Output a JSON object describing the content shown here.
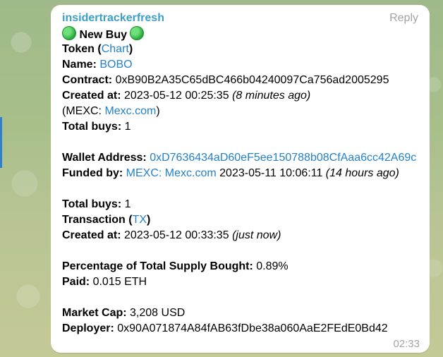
{
  "message": {
    "sender": "insidertrackerfresh",
    "reply_label": "Reply",
    "headline": "New Buy",
    "token_label": "Token",
    "token_open": "(",
    "token_link": "Chart",
    "token_close": ")",
    "name_label": "Name:",
    "name_value": "BOBO",
    "contract_label": "Contract:",
    "contract_value": "0xB90B2A35C65dBC466b04240097Ca756ad2005295",
    "created1_label": "Created at:",
    "created1_value": "2023-05-12 00:25:35",
    "created1_relative": "(8 minutes ago)",
    "exchange_open": "(MEXC:",
    "exchange_link": "Mexc.com",
    "exchange_close": ")",
    "total_buys1_label": "Total buys:",
    "total_buys1_value": "1",
    "wallet_label": "Wallet Address:",
    "wallet_value": "0xD7636434aD60eF5ee150788b08CfAaa6cc42A69c",
    "funded_label": "Funded by:",
    "funded_link": "MEXC: Mexc.com",
    "funded_date": "2023-05-11 10:06:11",
    "funded_relative": "(14 hours ago)",
    "total_buys2_label": "Total buys:",
    "total_buys2_value": "1",
    "tx_label": "Transaction",
    "tx_open": "(",
    "tx_link": "TX",
    "tx_close": ")",
    "created2_label": "Created at:",
    "created2_value": "2023-05-12 00:33:35",
    "created2_relative": "(just now)",
    "supply_label": "Percentage of Total Supply Bought:",
    "supply_value": "0.89%",
    "paid_label": "Paid:",
    "paid_value": "0.015 ETH",
    "mcap_label": "Market Cap:",
    "mcap_value": "3,208 USD",
    "deployer_label": "Deployer:",
    "deployer_value": "0x90A071874A84fAB63fDbe38a060AaE2FEdE0Bd42",
    "time": "02:33"
  },
  "colors": {
    "sender": "#3c9fc8",
    "link": "#2481cc",
    "meta": "#a3a3a3",
    "accent": "#2f7fd1"
  }
}
